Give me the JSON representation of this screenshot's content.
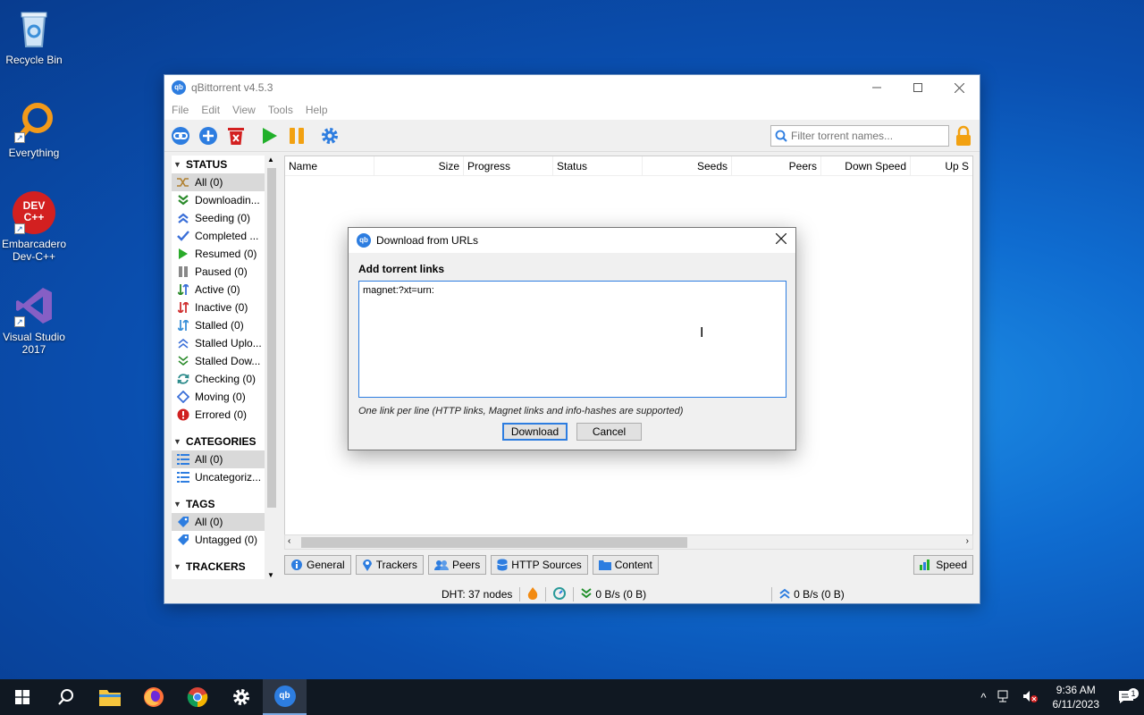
{
  "desktop": {
    "icons": [
      {
        "label": "Recycle Bin"
      },
      {
        "label": "Everything"
      },
      {
        "label": "Embarcadero Dev-C++",
        "logo_text": "DEV C++"
      },
      {
        "label": "Visual Studio 2017"
      }
    ]
  },
  "window": {
    "title": "qBittorrent v4.5.3",
    "app_badge": "qb",
    "menu": [
      "File",
      "Edit",
      "View",
      "Tools",
      "Help"
    ],
    "filter_placeholder": "Filter torrent names..."
  },
  "sidebar": {
    "status_header": "STATUS",
    "status_items": [
      {
        "label": "All (0)",
        "icon": "shuffle-icon",
        "color": "#b08030"
      },
      {
        "label": "Downloadin...",
        "icon": "download-icon",
        "color": "#2a8a2a"
      },
      {
        "label": "Seeding (0)",
        "icon": "upload-icon",
        "color": "#3a6fd8"
      },
      {
        "label": "Completed ...",
        "icon": "check-icon",
        "color": "#3a6fd8"
      },
      {
        "label": "Resumed (0)",
        "icon": "play-icon",
        "color": "#2aaa2a"
      },
      {
        "label": "Paused (0)",
        "icon": "pause-icon",
        "color": "#888888"
      },
      {
        "label": "Active (0)",
        "icon": "active-icon",
        "color": "#2a8a2a"
      },
      {
        "label": "Inactive (0)",
        "icon": "inactive-icon",
        "color": "#d03030"
      },
      {
        "label": "Stalled (0)",
        "icon": "stalled-icon",
        "color": "#3a90d8"
      },
      {
        "label": "Stalled Uplo...",
        "icon": "stalled-upload-icon",
        "color": "#3a6fd8"
      },
      {
        "label": "Stalled Dow...",
        "icon": "stalled-download-icon",
        "color": "#2a8a2a"
      },
      {
        "label": "Checking (0)",
        "icon": "refresh-icon",
        "color": "#2a8a8a"
      },
      {
        "label": "Moving (0)",
        "icon": "moving-icon",
        "color": "#3a6fd8"
      },
      {
        "label": "Errored (0)",
        "icon": "error-icon",
        "color": "#d02020"
      }
    ],
    "categories_header": "CATEGORIES",
    "category_items": [
      {
        "label": "All (0)"
      },
      {
        "label": "Uncategoriz..."
      }
    ],
    "tags_header": "TAGS",
    "tag_items": [
      {
        "label": "All (0)"
      },
      {
        "label": "Untagged (0)"
      }
    ],
    "trackers_header": "TRACKERS"
  },
  "columns": [
    "Name",
    "Size",
    "Progress",
    "Status",
    "Seeds",
    "Peers",
    "Down Speed",
    "Up S"
  ],
  "tabs": [
    "General",
    "Trackers",
    "Peers",
    "HTTP Sources",
    "Content"
  ],
  "speed_tab": "Speed",
  "statusbar": {
    "dht": "DHT: 37 nodes",
    "down": "0 B/s (0 B)",
    "up": "0 B/s (0 B)"
  },
  "dialog": {
    "title": "Download from URLs",
    "label": "Add torrent links",
    "text": "magnet:?xt=urn:",
    "hint": "One link per line (HTTP links, Magnet links and info-hashes are supported)",
    "download_label": "Download",
    "cancel_label": "Cancel"
  },
  "taskbar": {
    "time": "9:36 AM",
    "date": "6/11/2023",
    "notification_count": "1"
  },
  "colors": {
    "accent": "#2d7de0",
    "taskbar": "#101822"
  }
}
